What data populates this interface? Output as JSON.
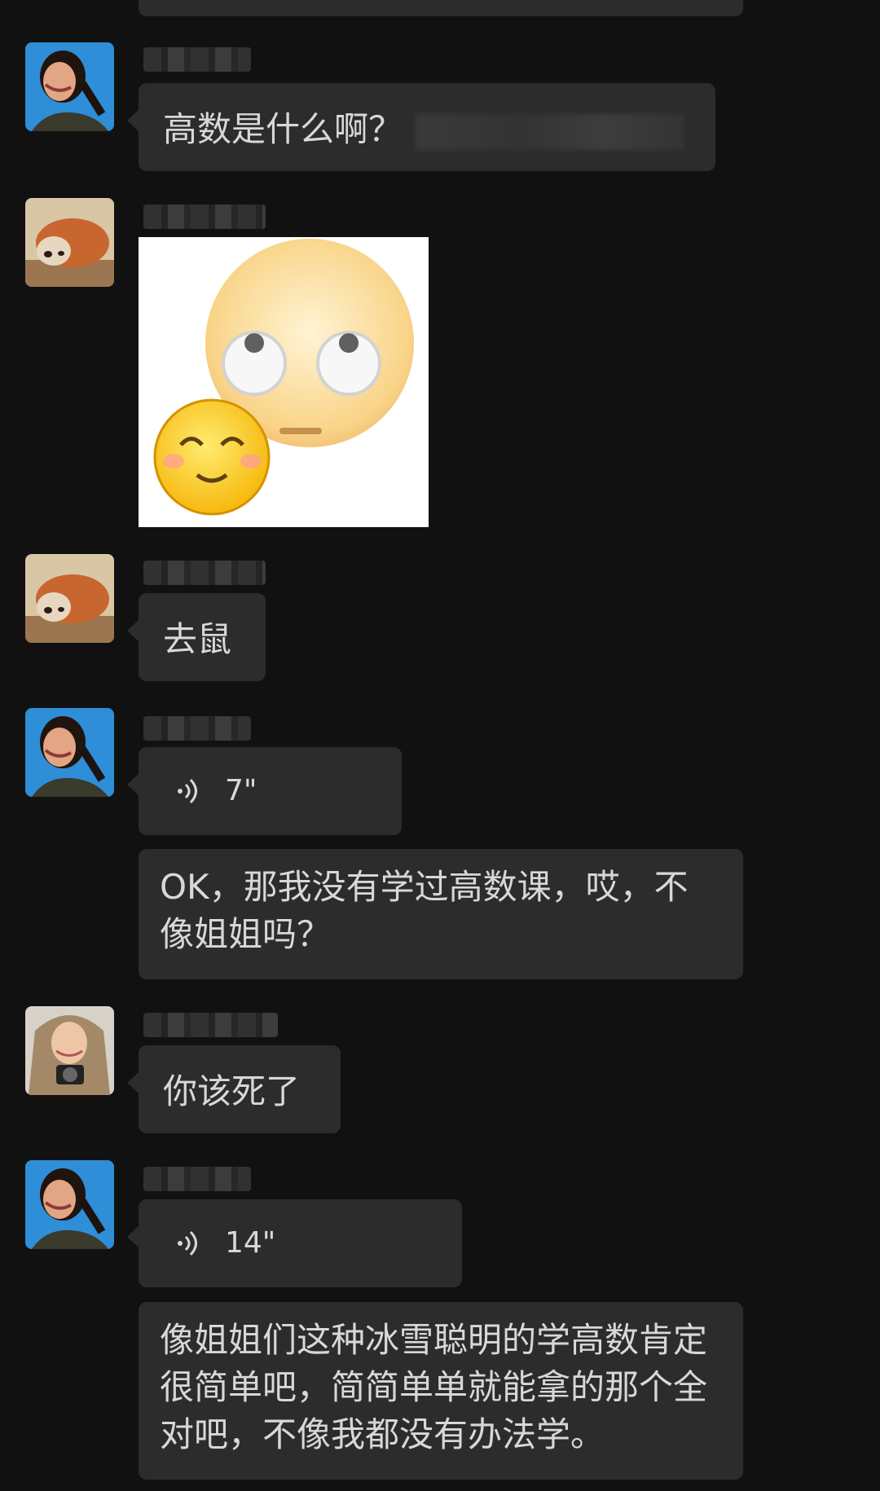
{
  "messages": [
    {
      "id": "m1",
      "type": "text",
      "text": "高数是什么啊？",
      "avatar": "girl-laughing-avatar"
    },
    {
      "id": "m2",
      "type": "sticker",
      "sticker": "eye-roll-and-smiling-emoji-sticker",
      "avatar": "red-panda-avatar"
    },
    {
      "id": "m3",
      "type": "text",
      "text": "去鼠",
      "avatar": "red-panda-avatar"
    },
    {
      "id": "m4",
      "type": "voice",
      "duration": "7\"",
      "avatar": "girl-laughing-avatar"
    },
    {
      "id": "m5",
      "type": "text",
      "text": "OK，那我没有学过高数课，哎，不像姐姐吗？"
    },
    {
      "id": "m6",
      "type": "text",
      "text": "你该死了",
      "avatar": "girl-with-camera-avatar"
    },
    {
      "id": "m7",
      "type": "voice",
      "duration": "14\"",
      "avatar": "girl-laughing-avatar"
    },
    {
      "id": "m8",
      "type": "text",
      "text": "像姐姐们这种冰雪聪明的学高数肯定很简单吧，简简单单就能拿的那个全对吧，不像我都没有办法学。"
    }
  ],
  "colors": {
    "background": "#111111",
    "bubble": "#2c2c2c",
    "text": "#d8d8d8"
  }
}
